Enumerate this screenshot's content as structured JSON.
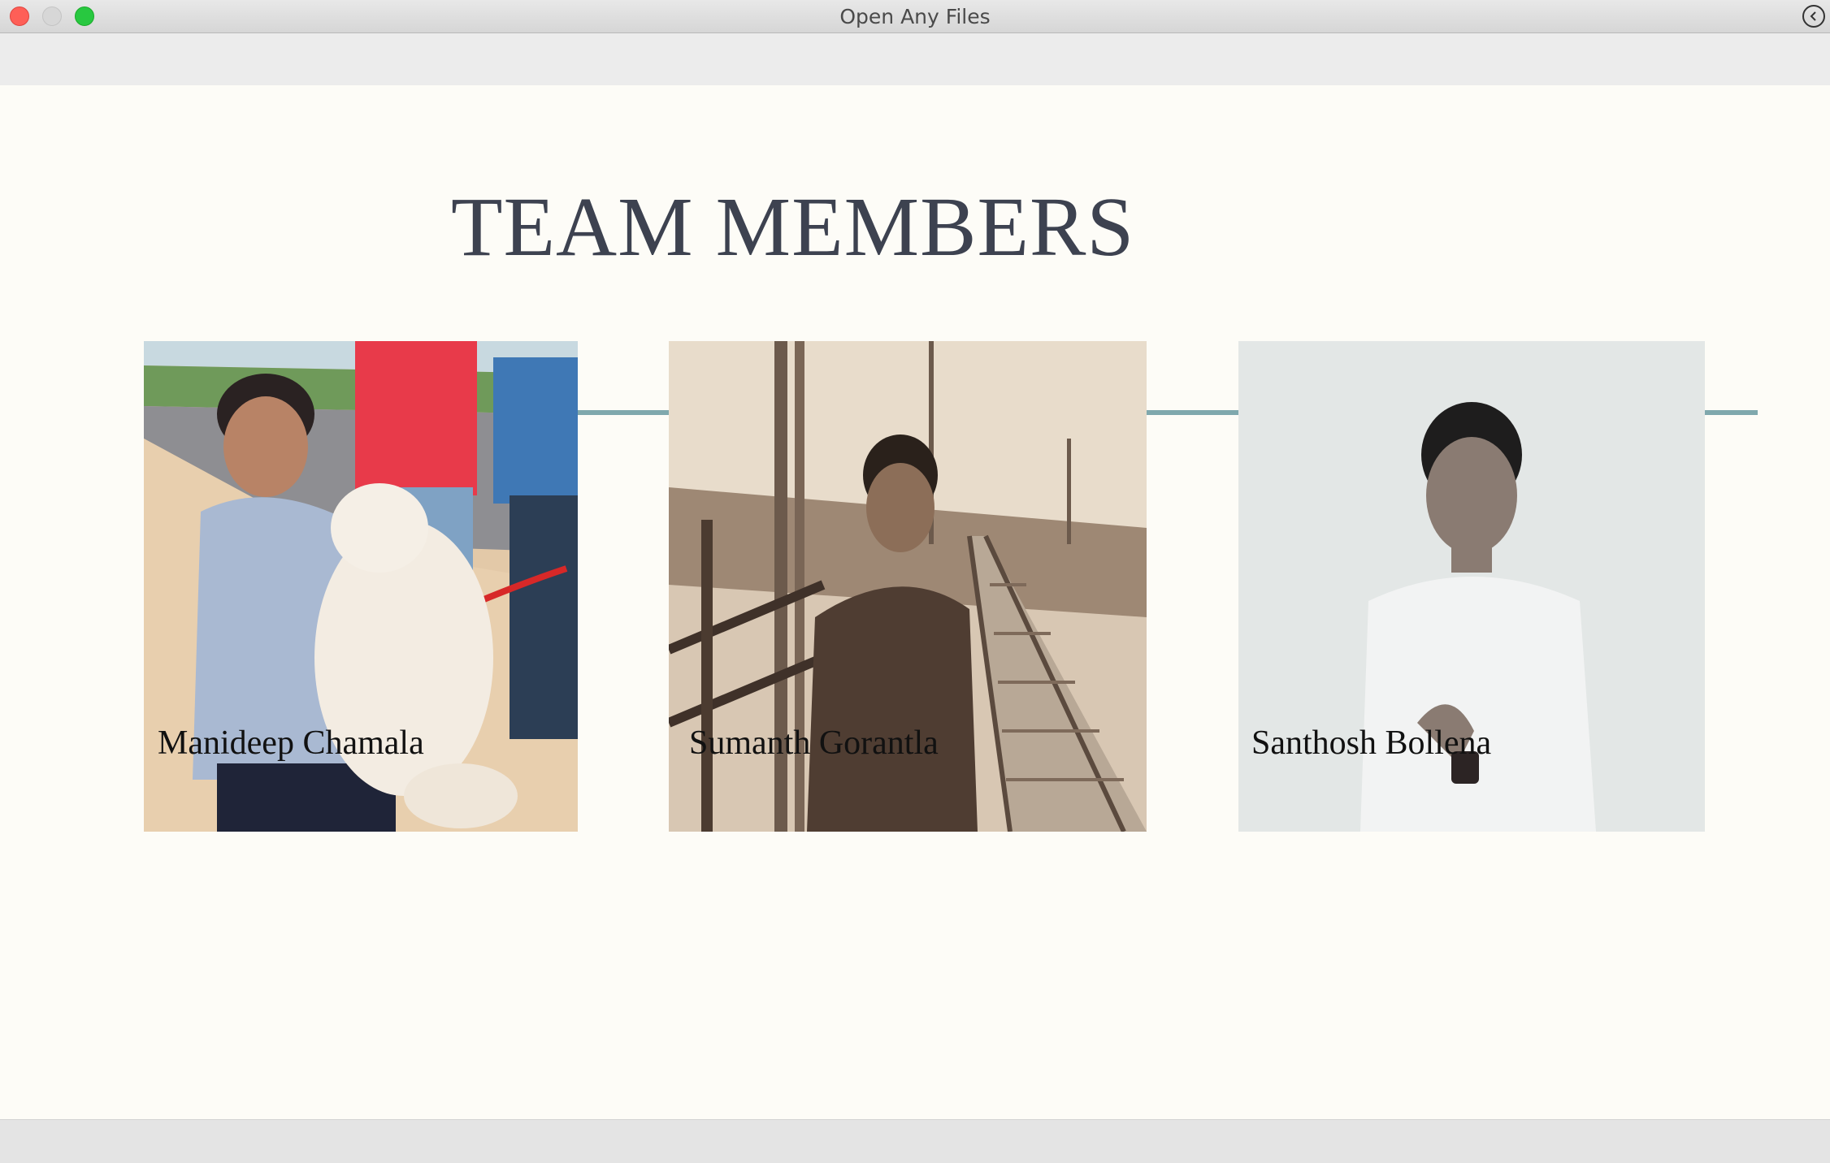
{
  "window": {
    "title": "Open Any Files"
  },
  "icons": {
    "back": "back-arrow-circle-icon"
  },
  "page": {
    "heading": "TEAM MEMBERS"
  },
  "colors": {
    "accent_line": "#7fa8ad",
    "heading": "#3d4250",
    "background": "#fdfcf7"
  },
  "members": [
    {
      "name": "Manideep Chamala"
    },
    {
      "name": "Sumanth Gorantla"
    },
    {
      "name": "Santhosh Bollena"
    }
  ]
}
